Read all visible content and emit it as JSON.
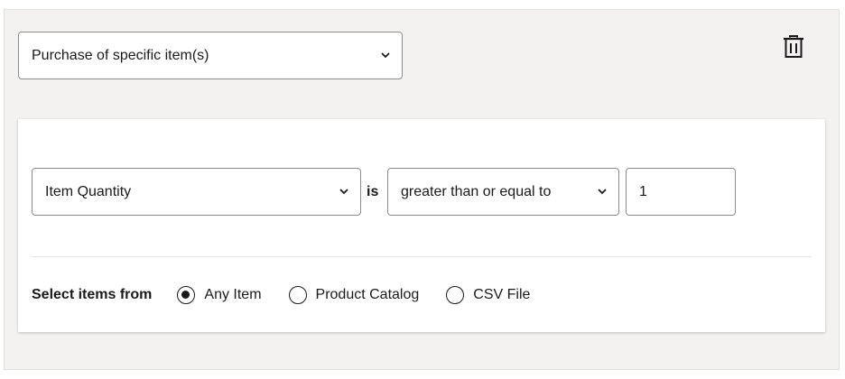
{
  "rule": {
    "trigger_select": {
      "value": "Purchase of specific item(s)"
    },
    "delete_icon": "trash-icon"
  },
  "condition": {
    "attribute_select": {
      "value": "Item Quantity"
    },
    "is_label": "is",
    "operator_select": {
      "value": "greater than or equal to"
    },
    "value_input": {
      "value": "1"
    }
  },
  "item_source": {
    "label": "Select items from",
    "options": [
      {
        "label": "Any Item",
        "selected": true
      },
      {
        "label": "Product Catalog",
        "selected": false
      },
      {
        "label": "CSV File",
        "selected": false
      }
    ]
  }
}
